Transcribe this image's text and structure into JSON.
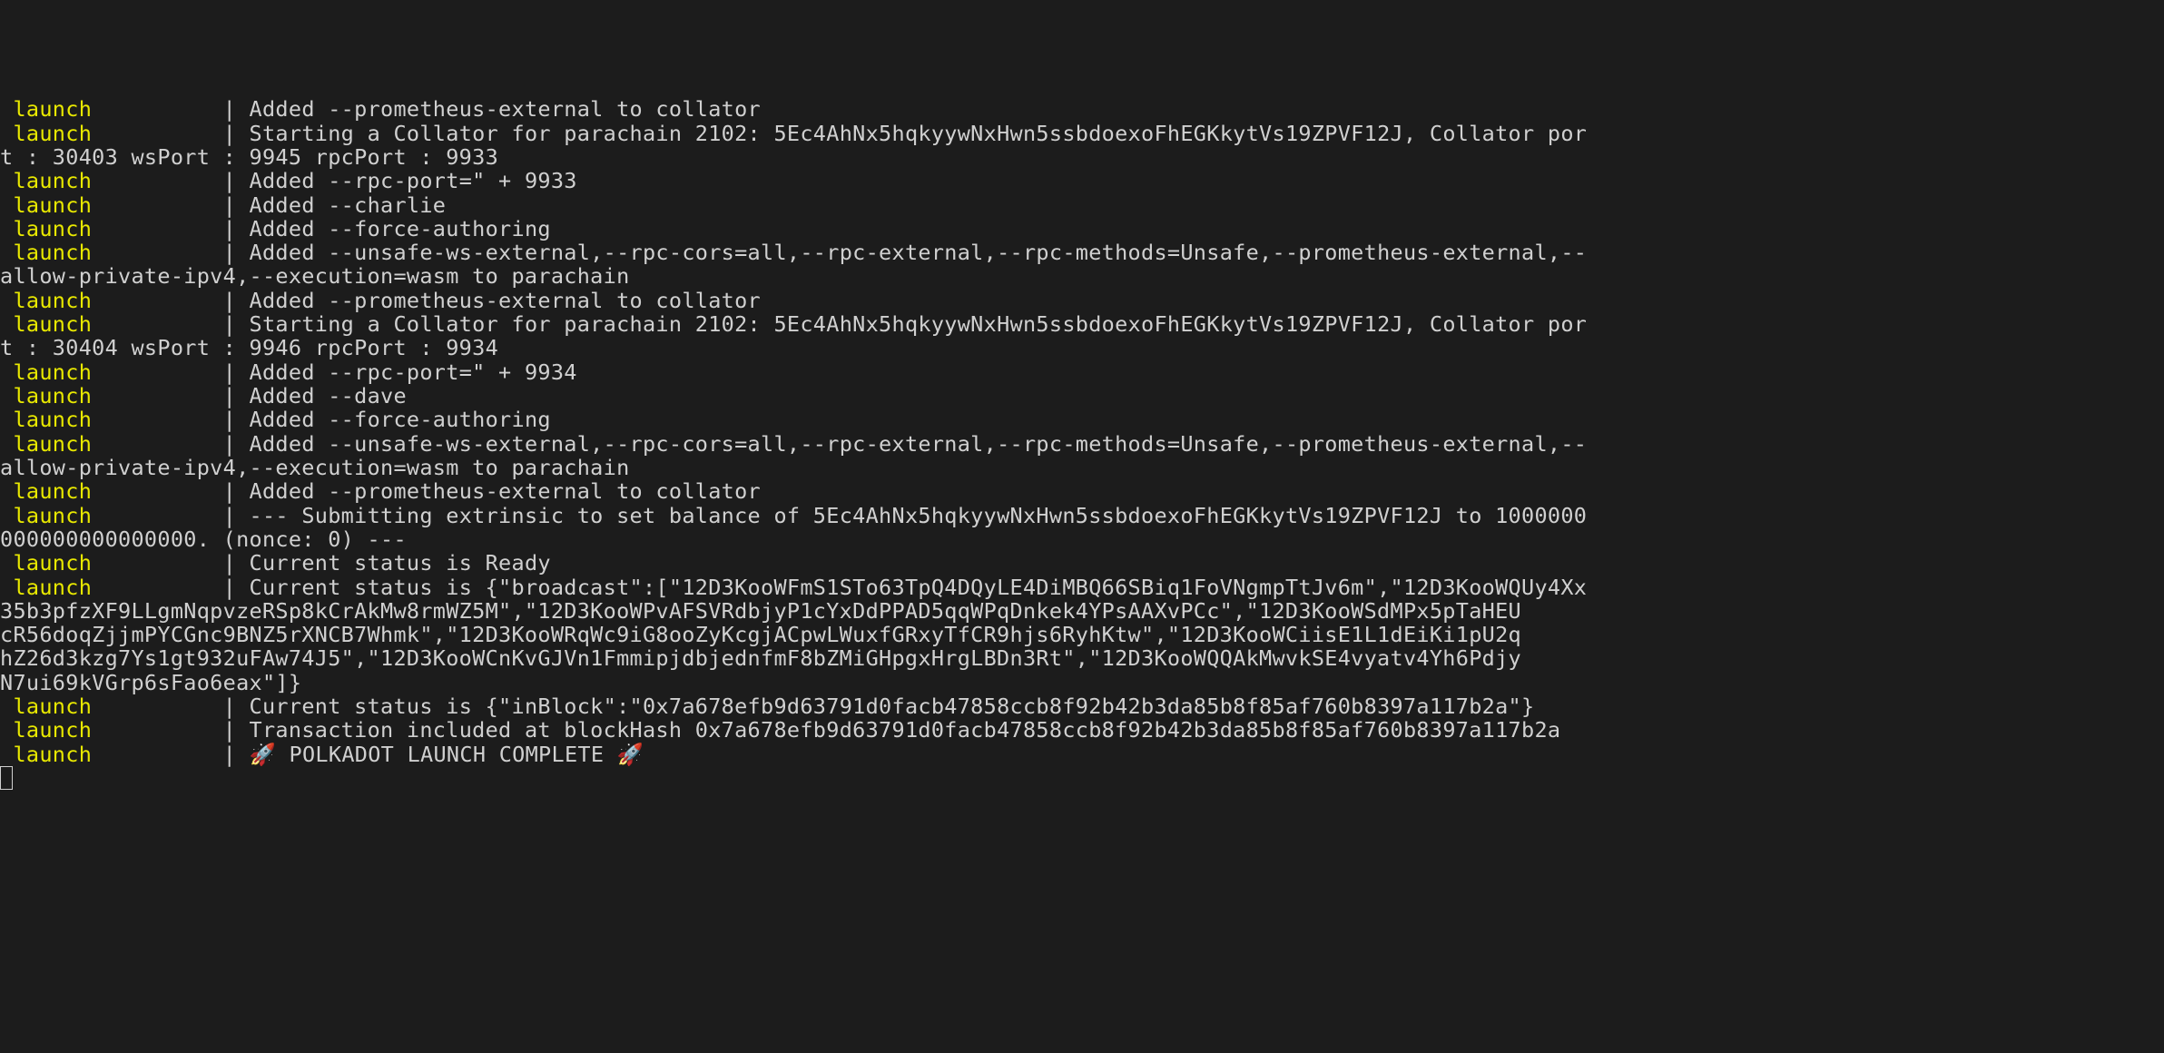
{
  "terminal": {
    "tag_text": "launch          ",
    "lines": [
      {
        "tag": true,
        "msg": "Added --prometheus-external to collator"
      },
      {
        "tag": true,
        "msg": "Starting a Collator for parachain 2102: 5Ec4AhNx5hqkyywNxHwn5ssbdoexoFhEGKkytVs19ZPVF12J, Collator por"
      },
      {
        "tag": false,
        "msg": "t : 30403 wsPort : 9945 rpcPort : 9933"
      },
      {
        "tag": true,
        "msg": "Added --rpc-port=\" + 9933"
      },
      {
        "tag": true,
        "msg": "Added --charlie"
      },
      {
        "tag": true,
        "msg": "Added --force-authoring"
      },
      {
        "tag": true,
        "msg": "Added --unsafe-ws-external,--rpc-cors=all,--rpc-external,--rpc-methods=Unsafe,--prometheus-external,--"
      },
      {
        "tag": false,
        "msg": "allow-private-ipv4,--execution=wasm to parachain"
      },
      {
        "tag": true,
        "msg": "Added --prometheus-external to collator"
      },
      {
        "tag": true,
        "msg": "Starting a Collator for parachain 2102: 5Ec4AhNx5hqkyywNxHwn5ssbdoexoFhEGKkytVs19ZPVF12J, Collator por"
      },
      {
        "tag": false,
        "msg": "t : 30404 wsPort : 9946 rpcPort : 9934"
      },
      {
        "tag": true,
        "msg": "Added --rpc-port=\" + 9934"
      },
      {
        "tag": true,
        "msg": "Added --dave"
      },
      {
        "tag": true,
        "msg": "Added --force-authoring"
      },
      {
        "tag": true,
        "msg": "Added --unsafe-ws-external,--rpc-cors=all,--rpc-external,--rpc-methods=Unsafe,--prometheus-external,--"
      },
      {
        "tag": false,
        "msg": "allow-private-ipv4,--execution=wasm to parachain"
      },
      {
        "tag": true,
        "msg": "Added --prometheus-external to collator"
      },
      {
        "tag": true,
        "msg": "--- Submitting extrinsic to set balance of 5Ec4AhNx5hqkyywNxHwn5ssbdoexoFhEGKkytVs19ZPVF12J to 1000000"
      },
      {
        "tag": false,
        "msg": "000000000000000. (nonce: 0) ---"
      },
      {
        "tag": true,
        "msg": "Current status is Ready"
      },
      {
        "tag": true,
        "msg": "Current status is {\"broadcast\":[\"12D3KooWFmS1STo63TpQ4DQyLE4DiMBQ66SBiq1FoVNgmpTtJv6m\",\"12D3KooWQUy4Xx"
      },
      {
        "tag": false,
        "msg": "35b3pfzXF9LLgmNqpvzeRSp8kCrAkMw8rmWZ5M\",\"12D3KooWPvAFSVRdbjyP1cYxDdPPAD5qqWPqDnkek4YPsAAXvPCc\",\"12D3KooWSdMPx5pTaHEU"
      },
      {
        "tag": false,
        "msg": "cR56doqZjjmPYCGnc9BNZ5rXNCB7Whmk\",\"12D3KooWRqWc9iG8ooZyKcgjACpwLWuxfGRxyTfCR9hjs6RyhKtw\",\"12D3KooWCiisE1L1dEiKi1pU2q"
      },
      {
        "tag": false,
        "msg": "hZ26d3kzg7Ys1gt932uFAw74J5\",\"12D3KooWCnKvGJVn1FmmipjdbjednfmF8bZMiGHpgxHrgLBDn3Rt\",\"12D3KooWQQAkMwvkSE4vyatv4Yh6Pdjy"
      },
      {
        "tag": false,
        "msg": "N7ui69kVGrp6sFao6eax\"]}"
      },
      {
        "tag": true,
        "msg": "Current status is {\"inBlock\":\"0x7a678efb9d63791d0facb47858ccb8f92b42b3da85b8f85af760b8397a117b2a\"}"
      },
      {
        "tag": true,
        "msg": "Transaction included at blockHash 0x7a678efb9d63791d0facb47858ccb8f92b42b3da85b8f85af760b8397a117b2a"
      },
      {
        "tag": true,
        "msg": "🚀 POLKADOT LAUNCH COMPLETE 🚀"
      }
    ]
  }
}
